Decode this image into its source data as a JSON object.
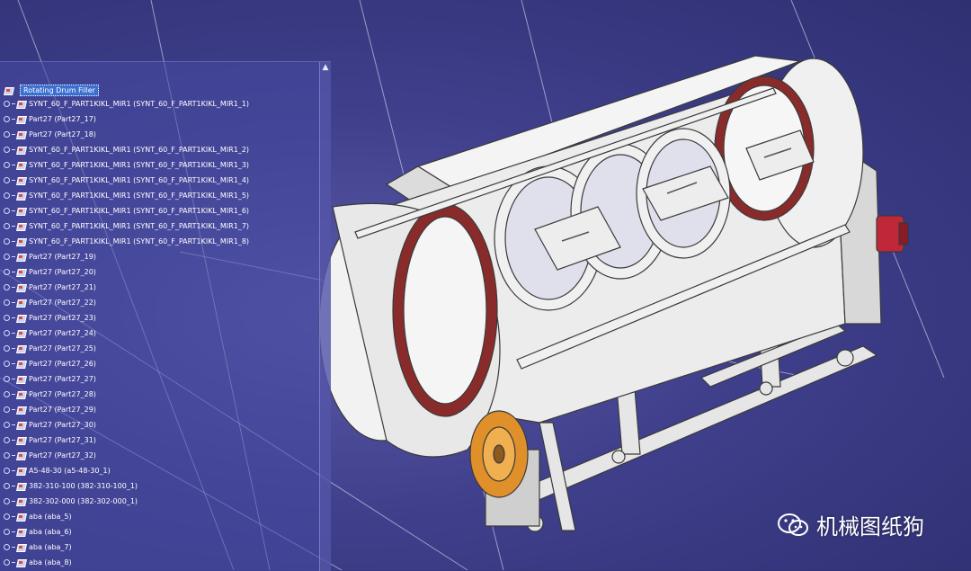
{
  "tree": {
    "root_label": "Rotating Drum Filler",
    "items": [
      "SYNT_60_F_PART1KIKL_MIR1 (SYNT_60_F_PART1KIKL_MIR1_1)",
      "Part27 (Part27_17)",
      "Part27 (Part27_18)",
      "SYNT_60_F_PART1KIKL_MIR1 (SYNT_60_F_PART1KIKL_MIR1_2)",
      "SYNT_60_F_PART1KIKL_MIR1 (SYNT_60_F_PART1KIKL_MIR1_3)",
      "SYNT_60_F_PART1KIKL_MIR1 (SYNT_60_F_PART1KIKL_MIR1_4)",
      "SYNT_60_F_PART1KIKL_MIR1 (SYNT_60_F_PART1KIKL_MIR1_5)",
      "SYNT_60_F_PART1KIKL_MIR1 (SYNT_60_F_PART1KIKL_MIR1_6)",
      "SYNT_60_F_PART1KIKL_MIR1 (SYNT_60_F_PART1KIKL_MIR1_7)",
      "SYNT_60_F_PART1KIKL_MIR1 (SYNT_60_F_PART1KIKL_MIR1_8)",
      "Part27 (Part27_19)",
      "Part27 (Part27_20)",
      "Part27 (Part27_21)",
      "Part27 (Part27_22)",
      "Part27 (Part27_23)",
      "Part27 (Part27_24)",
      "Part27 (Part27_25)",
      "Part27 (Part27_26)",
      "Part27 (Part27_27)",
      "Part27 (Part27_28)",
      "Part27 (Part27_29)",
      "Part27 (Part27_30)",
      "Part27 (Part27_31)",
      "Part27 (Part27_32)",
      "A5-48-30 (a5-48-30_1)",
      "382-310-100 (382-310-100_1)",
      "382-302-000 (382-302-000_1)",
      "aba (aba_5)",
      "aba (aba_6)",
      "aba (aba_7)",
      "aba (aba_8)"
    ]
  },
  "scroll_icon": "arrow-up-icon",
  "watermark": {
    "icon": "wechat-icon",
    "text": "机械图纸狗"
  },
  "colors": {
    "background": "#3f3f8c",
    "drum_band": "#8a2b2b",
    "pulley": "#e0902a",
    "motor": "#c0283a"
  }
}
